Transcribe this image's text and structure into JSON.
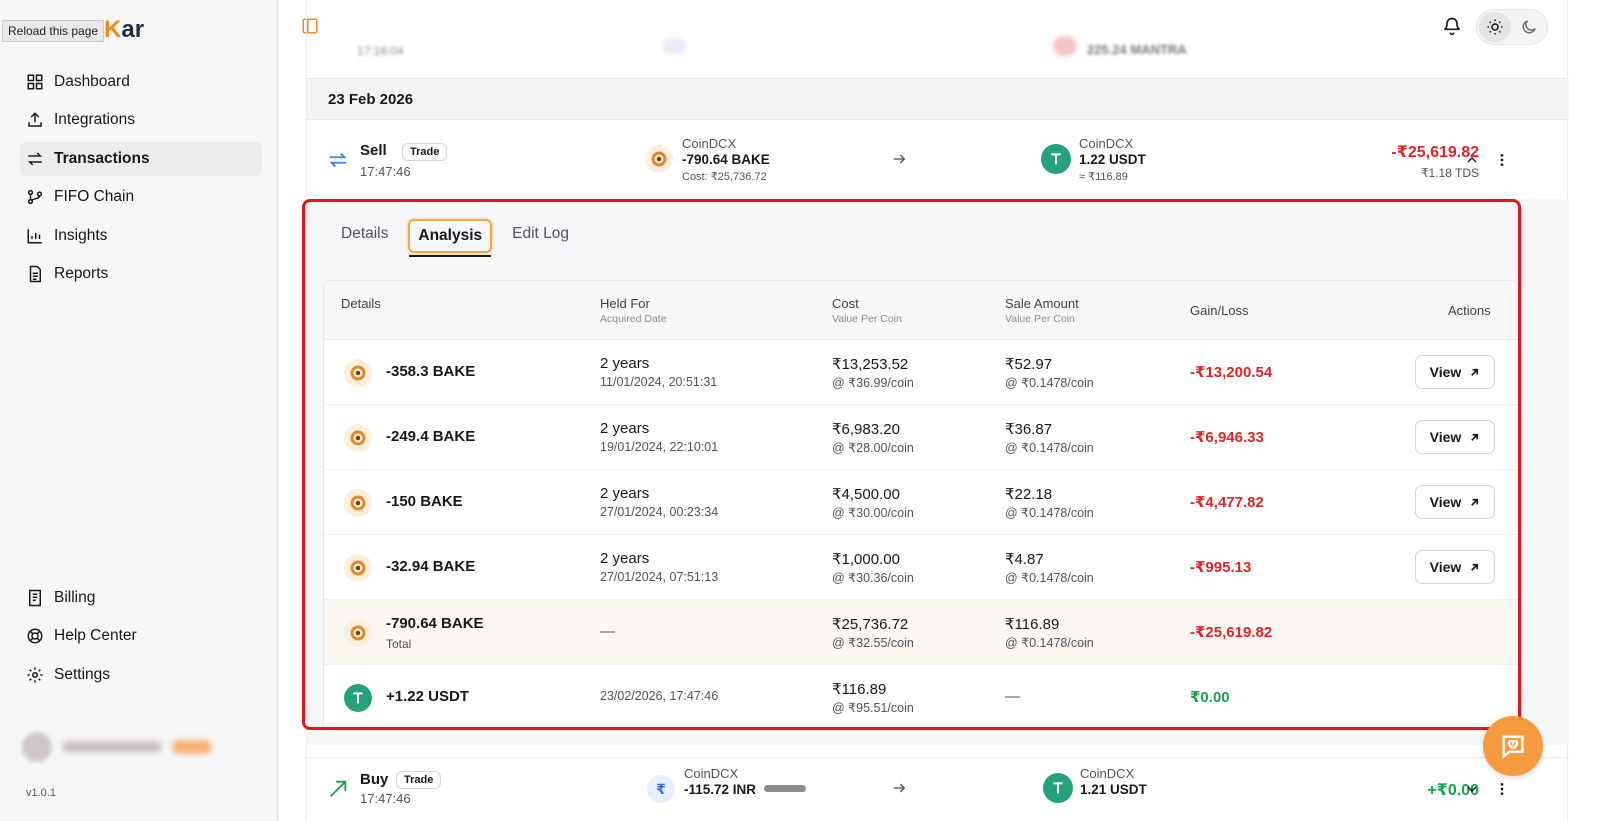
{
  "browser": {
    "tooltip": "Reload this page"
  },
  "sidebar": {
    "logo_prefix": "",
    "logo_k": "K",
    "logo_suffix": "ar",
    "items": [
      {
        "label": "Dashboard",
        "icon": "dashboard-icon"
      },
      {
        "label": "Integrations",
        "icon": "upload-icon"
      },
      {
        "label": "Transactions",
        "icon": "arrows-swap-icon",
        "active": true
      },
      {
        "label": "FIFO Chain",
        "icon": "git-branch-icon"
      },
      {
        "label": "Insights",
        "icon": "bar-chart-icon"
      },
      {
        "label": "Reports",
        "icon": "document-icon"
      }
    ],
    "bottom_items": [
      {
        "label": "Billing",
        "icon": "receipt-icon"
      },
      {
        "label": "Help Center",
        "icon": "lifebuoy-icon"
      },
      {
        "label": "Settings",
        "icon": "gear-icon"
      }
    ],
    "version": "v1.0.1"
  },
  "header": {
    "icons": [
      "sidebar-toggle-icon",
      "bell-icon",
      "sun-icon",
      "moon-icon"
    ]
  },
  "date_group": "23 Feb 2026",
  "ghost_row": {
    "time": "17:16:04",
    "amount": "225.24 MANTRA"
  },
  "sell_txn": {
    "type": "Sell",
    "badge": "Trade",
    "time": "17:47:46",
    "from_exchange": "CoinDCX",
    "from_amount": "-790.64 BAKE",
    "from_cost": "Cost: ₹25,736.72",
    "to_exchange": "CoinDCX",
    "to_amount": "1.22 USDT",
    "to_value": "≈ ₹116.89",
    "total": "-₹25,619.82",
    "tds": "₹1.18 TDS"
  },
  "tabs": [
    "Details",
    "Analysis",
    "Edit Log"
  ],
  "analysis": {
    "headers": {
      "details": "Details",
      "held_for": "Held For",
      "held_for_sub": "Acquired Date",
      "cost": "Cost",
      "cost_sub": "Value Per Coin",
      "sale": "Sale Amount",
      "sale_sub": "Value Per Coin",
      "gain": "Gain/Loss",
      "actions": "Actions"
    },
    "view_label": "View",
    "rows": [
      {
        "amount": "-358.3 BAKE",
        "held": "2 years",
        "acquired": "11/01/2024, 20:51:31",
        "cost": "₹13,253.52",
        "cost_per": "@ ₹36.99/coin",
        "sale": "₹52.97",
        "sale_per": "@ ₹0.1478/coin",
        "gain": "-₹13,200.54"
      },
      {
        "amount": "-249.4 BAKE",
        "held": "2 years",
        "acquired": "19/01/2024, 22:10:01",
        "cost": "₹6,983.20",
        "cost_per": "@ ₹28.00/coin",
        "sale": "₹36.87",
        "sale_per": "@ ₹0.1478/coin",
        "gain": "-₹6,946.33"
      },
      {
        "amount": "-150 BAKE",
        "held": "2 years",
        "acquired": "27/01/2024, 00:23:34",
        "cost": "₹4,500.00",
        "cost_per": "@ ₹30.00/coin",
        "sale": "₹22.18",
        "sale_per": "@ ₹0.1478/coin",
        "gain": "-₹4,477.82"
      },
      {
        "amount": "-32.94 BAKE",
        "held": "2 years",
        "acquired": "27/01/2024, 07:51:13",
        "cost": "₹1,000.00",
        "cost_per": "@ ₹30.36/coin",
        "sale": "₹4.87",
        "sale_per": "@ ₹0.1478/coin",
        "gain": "-₹995.13"
      }
    ],
    "total_row": {
      "amount": "-790.64 BAKE",
      "label": "Total",
      "held": "—",
      "cost": "₹25,736.72",
      "cost_per": "@ ₹32.55/coin",
      "sale": "₹116.89",
      "sale_per": "@ ₹0.1478/coin",
      "gain": "-₹25,619.82"
    },
    "usdt_row": {
      "amount": "+1.22 USDT",
      "acquired": "23/02/2026, 17:47:46",
      "cost": "₹116.89",
      "cost_per": "@ ₹95.51/coin",
      "sale": "—",
      "gain": "₹0.00"
    }
  },
  "buy_txn": {
    "type": "Buy",
    "badge": "Trade",
    "time": "17:47:46",
    "from_exchange": "CoinDCX",
    "from_amount": "-115.72 INR",
    "to_exchange": "CoinDCX",
    "to_amount": "1.21 USDT",
    "total": "+₹0.00"
  },
  "colors": {
    "accent": "#f59a3e",
    "negative": "#dc2626",
    "positive": "#16a34a",
    "highlight": "#e5141b"
  }
}
